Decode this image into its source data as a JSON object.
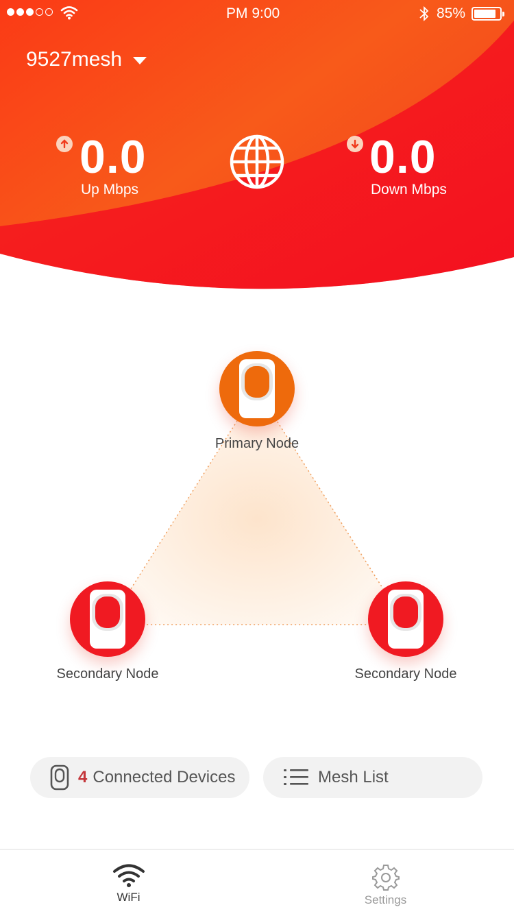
{
  "status_bar": {
    "time": "PM  9:00",
    "battery_pct": "85%",
    "signal_bars": 3,
    "battery_level": 0.85
  },
  "network": {
    "name": "9527mesh"
  },
  "speeds": {
    "up": {
      "value": "0.0",
      "label": "Up Mbps"
    },
    "down": {
      "value": "0.0",
      "label": "Down Mbps"
    }
  },
  "nodes": {
    "primary": {
      "label": "Primary Node",
      "color": "#ee6a0c"
    },
    "secondary_left": {
      "label": "Secondary Node",
      "color": "#f01a22"
    },
    "secondary_right": {
      "label": "Secondary Node",
      "color": "#f01a22"
    }
  },
  "actions": {
    "connected": {
      "count": "4",
      "label": "Connected Devices"
    },
    "mesh_list": {
      "label": "Mesh List"
    }
  },
  "tabs": [
    {
      "label": "WiFi",
      "icon": "wifi-icon",
      "active": true
    },
    {
      "label": "Settings",
      "icon": "gear-icon",
      "active": false
    }
  ],
  "colors": {
    "accent": "#f01a22",
    "orange": "#f56a1a",
    "active_tab": "#333333",
    "inactive_tab": "#999999"
  }
}
